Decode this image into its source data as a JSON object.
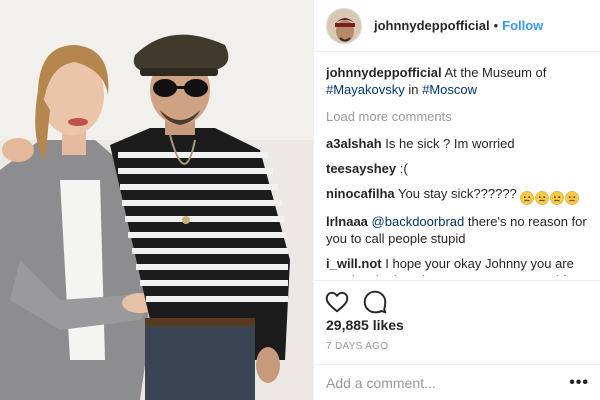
{
  "post": {
    "username": "johnnydeppofficial",
    "separator": "•",
    "follow_label": "Follow",
    "caption": {
      "username": "johnnydeppofficial",
      "text_before": "At the Museum of",
      "hashtag_1": "#Mayakovsky",
      "text_middle": "in",
      "hashtag_2": "#Moscow"
    },
    "load_more_label": "Load more comments",
    "comments": [
      {
        "username": "a3alshah",
        "text": "Is he sick ? Im worried"
      },
      {
        "username": "teesayshey",
        "text": ":("
      },
      {
        "username": "ninocafilha",
        "text": "You stay sick??????",
        "emoji_count": 4
      },
      {
        "username": "lrlnaaa",
        "mention": "@backdoorbrad",
        "text": "there's no reason for you to call people stupid"
      },
      {
        "username": "i_will.not",
        "text": "I hope your okay Johnny you are true inspiration I hope to see you around for"
      }
    ],
    "likes": "29,885 likes",
    "timestamp": "7 DAYS AGO",
    "add_comment_placeholder": "Add a comment...",
    "more_label": "•••"
  },
  "icons": {
    "like": "heart-icon",
    "comment": "comment-bubble-icon",
    "emoji": "worried-face-emoji",
    "avatar": "profile-avatar",
    "more": "more-options-icon"
  },
  "colors": {
    "link": "#3897f0",
    "hashtag": "#003569",
    "secondary": "#999999",
    "text": "#262626",
    "emoji": "#f7c948"
  }
}
